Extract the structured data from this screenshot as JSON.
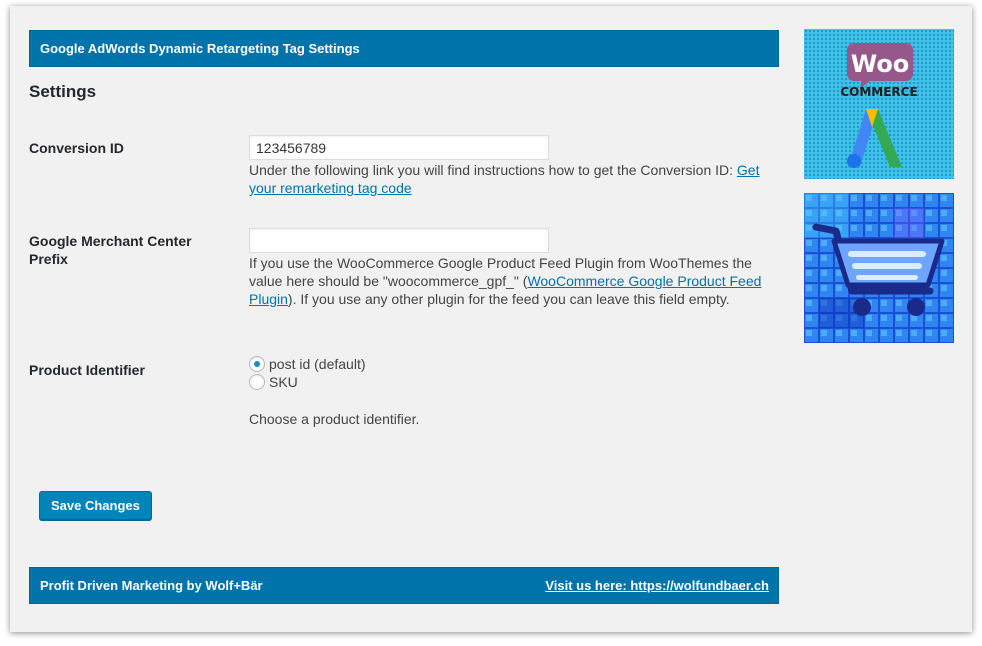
{
  "header": {
    "title": "Google AdWords Dynamic Retargeting Tag Settings"
  },
  "settings": {
    "heading": "Settings"
  },
  "conversion_id": {
    "label": "Conversion ID",
    "value": "123456789",
    "desc_text": "Under the following link you will find instructions how to get the Conversion ID: ",
    "desc_link": "Get your remarketing tag code"
  },
  "merchant_prefix": {
    "label": "Google Merchant Center Prefix",
    "value": "",
    "desc_before": "If you use the WooCommerce Google Product Feed Plugin from WooThemes the value here should be \"woocommerce_gpf_\" (",
    "desc_link": "WooCommerce Google Product Feed Plugin",
    "desc_after": "). If you use any other plugin for the feed you can leave this field empty."
  },
  "product_identifier": {
    "label": "Product Identifier",
    "options": [
      {
        "label": "post id (default)",
        "checked": true
      },
      {
        "label": "SKU",
        "checked": false
      }
    ],
    "description": "Choose a product identifier."
  },
  "save_button": {
    "label": "Save Changes"
  },
  "footer": {
    "left_text": "Profit Driven Marketing by Wolf+Bär",
    "link_text": "Visit us here: https://wolfundbaer.ch"
  },
  "banners": {
    "woo_logo_text": "Woo",
    "woo_commerce_text": "COMMERCE"
  },
  "colors": {
    "brand_blue": "#0073aa",
    "woo_purple": "#96588a",
    "adwords_blue": "#4285f4",
    "adwords_yellow": "#fbbc04",
    "adwords_green": "#34a853"
  }
}
